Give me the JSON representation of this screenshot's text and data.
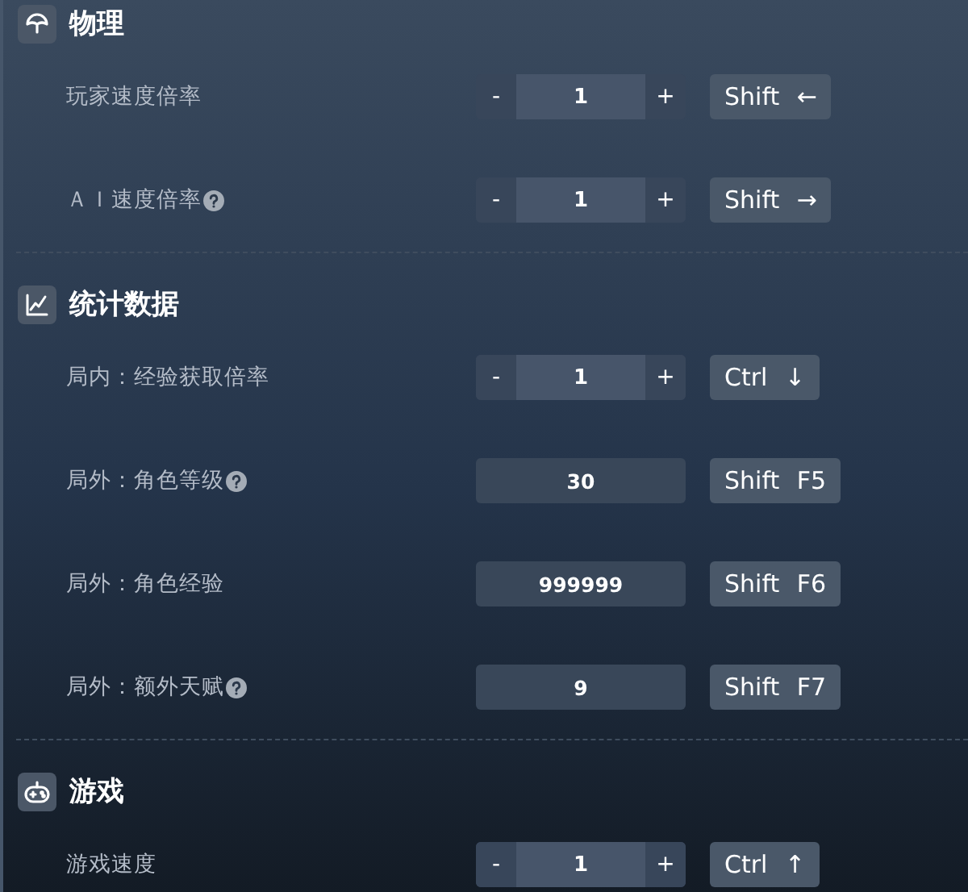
{
  "sections": [
    {
      "title": "物理",
      "rows": [
        {
          "label": "玩家速度倍率",
          "help": false,
          "kind": "stepper",
          "decrement": "-",
          "value": "1",
          "increment": "+",
          "hotkey": "Shift ←"
        },
        {
          "label": "ＡＩ速度倍率",
          "help": true,
          "kind": "stepper",
          "decrement": "-",
          "value": "1",
          "increment": "+",
          "hotkey": "Shift →"
        }
      ]
    },
    {
      "title": "统计数据",
      "rows": [
        {
          "label": "局内：经验获取倍率",
          "help": false,
          "kind": "stepper",
          "decrement": "-",
          "value": "1",
          "increment": "+",
          "hotkey": "Ctrl ↓"
        },
        {
          "label": "局外：角色等级",
          "help": true,
          "kind": "number",
          "value": "30",
          "hotkey": "Shift F5"
        },
        {
          "label": "局外：角色经验",
          "help": false,
          "kind": "number",
          "value": "999999",
          "hotkey": "Shift F6"
        },
        {
          "label": "局外：额外天赋",
          "help": true,
          "kind": "number",
          "value": "9",
          "hotkey": "Shift F7"
        }
      ]
    },
    {
      "title": "游戏",
      "rows": [
        {
          "label": "游戏速度",
          "help": false,
          "kind": "stepper",
          "decrement": "-",
          "value": "1",
          "increment": "+",
          "hotkey": "Ctrl ↑"
        }
      ]
    }
  ]
}
